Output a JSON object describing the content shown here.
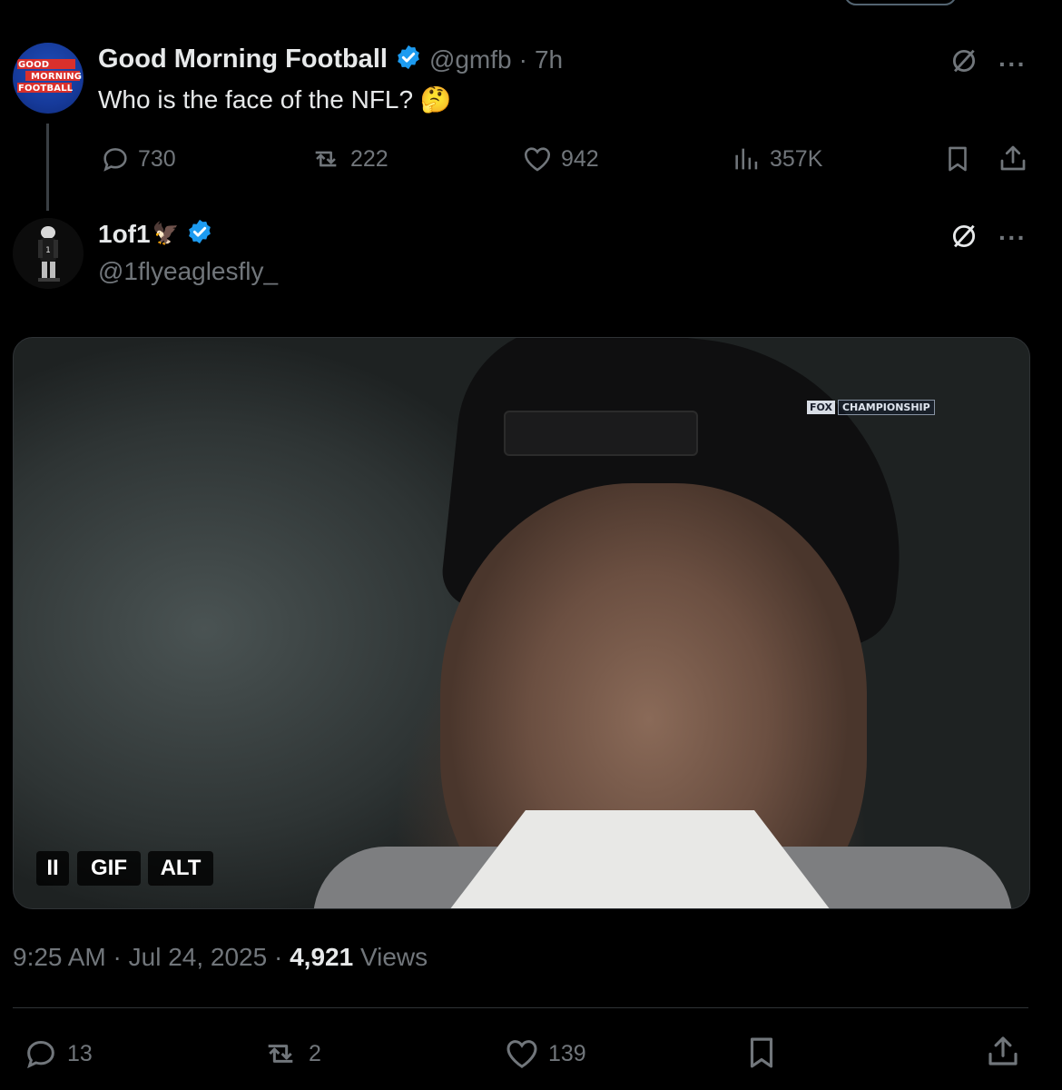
{
  "original_tweet": {
    "author_name": "Good Morning Football",
    "handle": "@gmfb",
    "separator": "·",
    "time_ago": "7h",
    "text": "Who is the face of the NFL?",
    "emoji": "🤔",
    "avatar_text": [
      "GOOD",
      "MORNING",
      "FOOTBALL"
    ],
    "stats": {
      "replies": "730",
      "reposts": "222",
      "likes": "942",
      "views": "357K"
    }
  },
  "reply_tweet": {
    "author_name": "1of1",
    "author_emoji": "🦅",
    "handle": "@1flyeaglesfly_",
    "media": {
      "overlay_text": "FOX",
      "overlay_text_2": "CHAMPIONSHIP",
      "controls": {
        "pause": "II",
        "gif": "GIF",
        "alt": "ALT"
      }
    },
    "time": "9:25 AM",
    "date": "Jul 24, 2025",
    "views_count": "4,921",
    "views_label": "Views",
    "separator": "·",
    "actions": {
      "replies": "13",
      "reposts": "2",
      "likes": "139"
    }
  },
  "colors": {
    "background": "#000000",
    "text_primary": "#e7e9ea",
    "text_muted": "#71767b",
    "verified": "#1d9bf0",
    "divider": "#2f3336"
  }
}
